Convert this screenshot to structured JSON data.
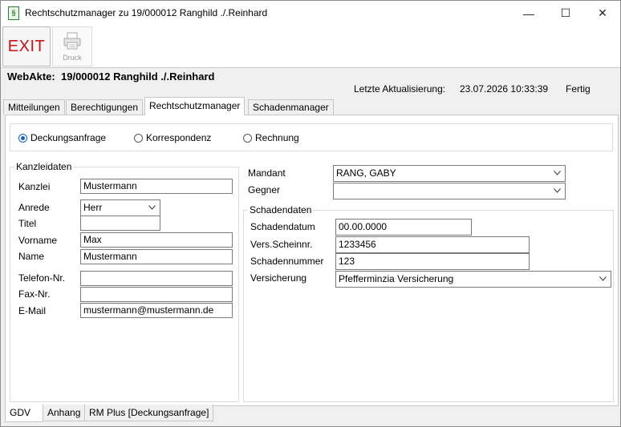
{
  "window": {
    "title": "Rechtschutzmanager zu 19/000012 Ranghild ./.Reinhard",
    "icon": "§",
    "controls": [
      "—",
      "☐",
      "✕"
    ]
  },
  "toolbar": {
    "exit_label": "EXIT",
    "print_label": "Druck"
  },
  "header": {
    "webakte_label": "WebAkte:",
    "webakte_value": "19/000012 Ranghild ./.Reinhard",
    "update_label": "Letzte Aktualisierung:",
    "update_value": "23.07.2026 10:33:39",
    "status": "Fertig"
  },
  "tabs": [
    {
      "label": "Mitteilungen",
      "active": false
    },
    {
      "label": "Berechtigungen",
      "active": false
    },
    {
      "label": "Rechtschutzmanager",
      "active": true
    },
    {
      "label": "Schadenmanager",
      "active": false
    }
  ],
  "radios": [
    {
      "label": "Deckungsanfrage",
      "checked": true
    },
    {
      "label": "Korrespondenz",
      "checked": false
    },
    {
      "label": "Rechnung",
      "checked": false
    }
  ],
  "kanzlei": {
    "group_title": "Kanzleidaten",
    "kanzlei_label": "Kanzlei",
    "kanzlei_value": "Mustermann",
    "anrede_label": "Anrede",
    "anrede_value": "Herr",
    "titel_label": "Titel",
    "titel_value": "",
    "vorname_label": "Vorname",
    "vorname_value": "Max",
    "name_label": "Name",
    "name_value": "Mustermann",
    "telefon_label": "Telefon-Nr.",
    "telefon_value": "",
    "fax_label": "Fax-Nr.",
    "fax_value": "",
    "email_label": "E-Mail",
    "email_value": "mustermann@mustermann.de"
  },
  "parties": {
    "mandant_label": "Mandant",
    "mandant_value": "RANG, GABY",
    "gegner_label": "Gegner",
    "gegner_value": ""
  },
  "schaden": {
    "group_title": "Schadendaten",
    "datum_label": "Schadendatum",
    "datum_value": "00.00.0000",
    "vers_label": "Vers.Scheinnr.",
    "vers_value": "1233456",
    "nummer_label": "Schadennummer",
    "nummer_value": "123",
    "versicherung_label": "Versicherung",
    "versicherung_value": "Pfefferminzia Versicherung"
  },
  "bottom_tabs": [
    {
      "label": "GDV",
      "active": true
    },
    {
      "label": "Anhang",
      "active": false
    },
    {
      "label": "RM Plus [Deckungsanfrage]",
      "active": false
    }
  ],
  "colors": {
    "exit_text": "#cc1111",
    "radio_accent": "#0a63c9",
    "window_bg": "#f0f0f0"
  }
}
